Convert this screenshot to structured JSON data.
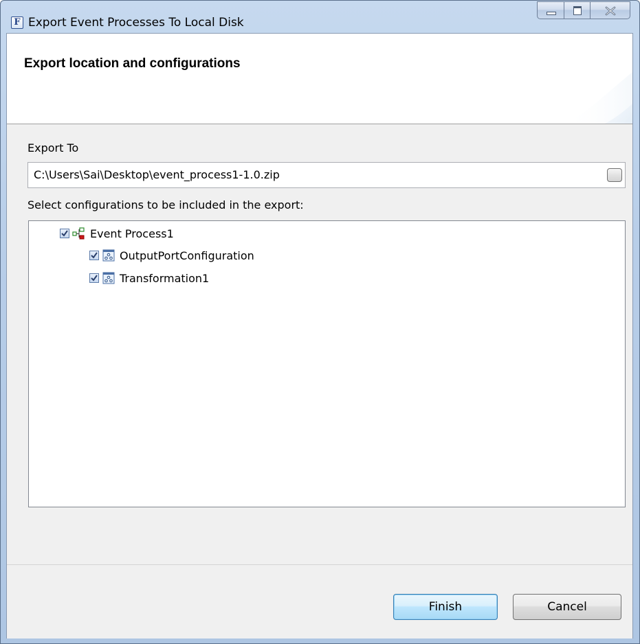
{
  "window": {
    "title": "Export Event Processes To Local Disk",
    "app_icon_letter": "F",
    "icon": "app-f-icon"
  },
  "header": {
    "title": "Export location and configurations"
  },
  "export_to": {
    "label": "Export To",
    "path": "C:\\Users\\Sai\\Desktop\\event_process1-1.0.zip"
  },
  "configurations": {
    "label": "Select configurations to be included in the export:",
    "tree": [
      {
        "label": "Event Process1",
        "checked": true,
        "icon": "event-process-icon"
      },
      {
        "label": "OutputPortConfiguration",
        "checked": true,
        "icon": "configuration-icon"
      },
      {
        "label": "Transformation1",
        "checked": true,
        "icon": "configuration-icon"
      }
    ]
  },
  "buttons": {
    "finish": "Finish",
    "cancel": "Cancel"
  },
  "colors": {
    "title_bar": "#b7cde8",
    "dialog_bg": "#f0f0f0",
    "default_button": "#bee6fd"
  }
}
